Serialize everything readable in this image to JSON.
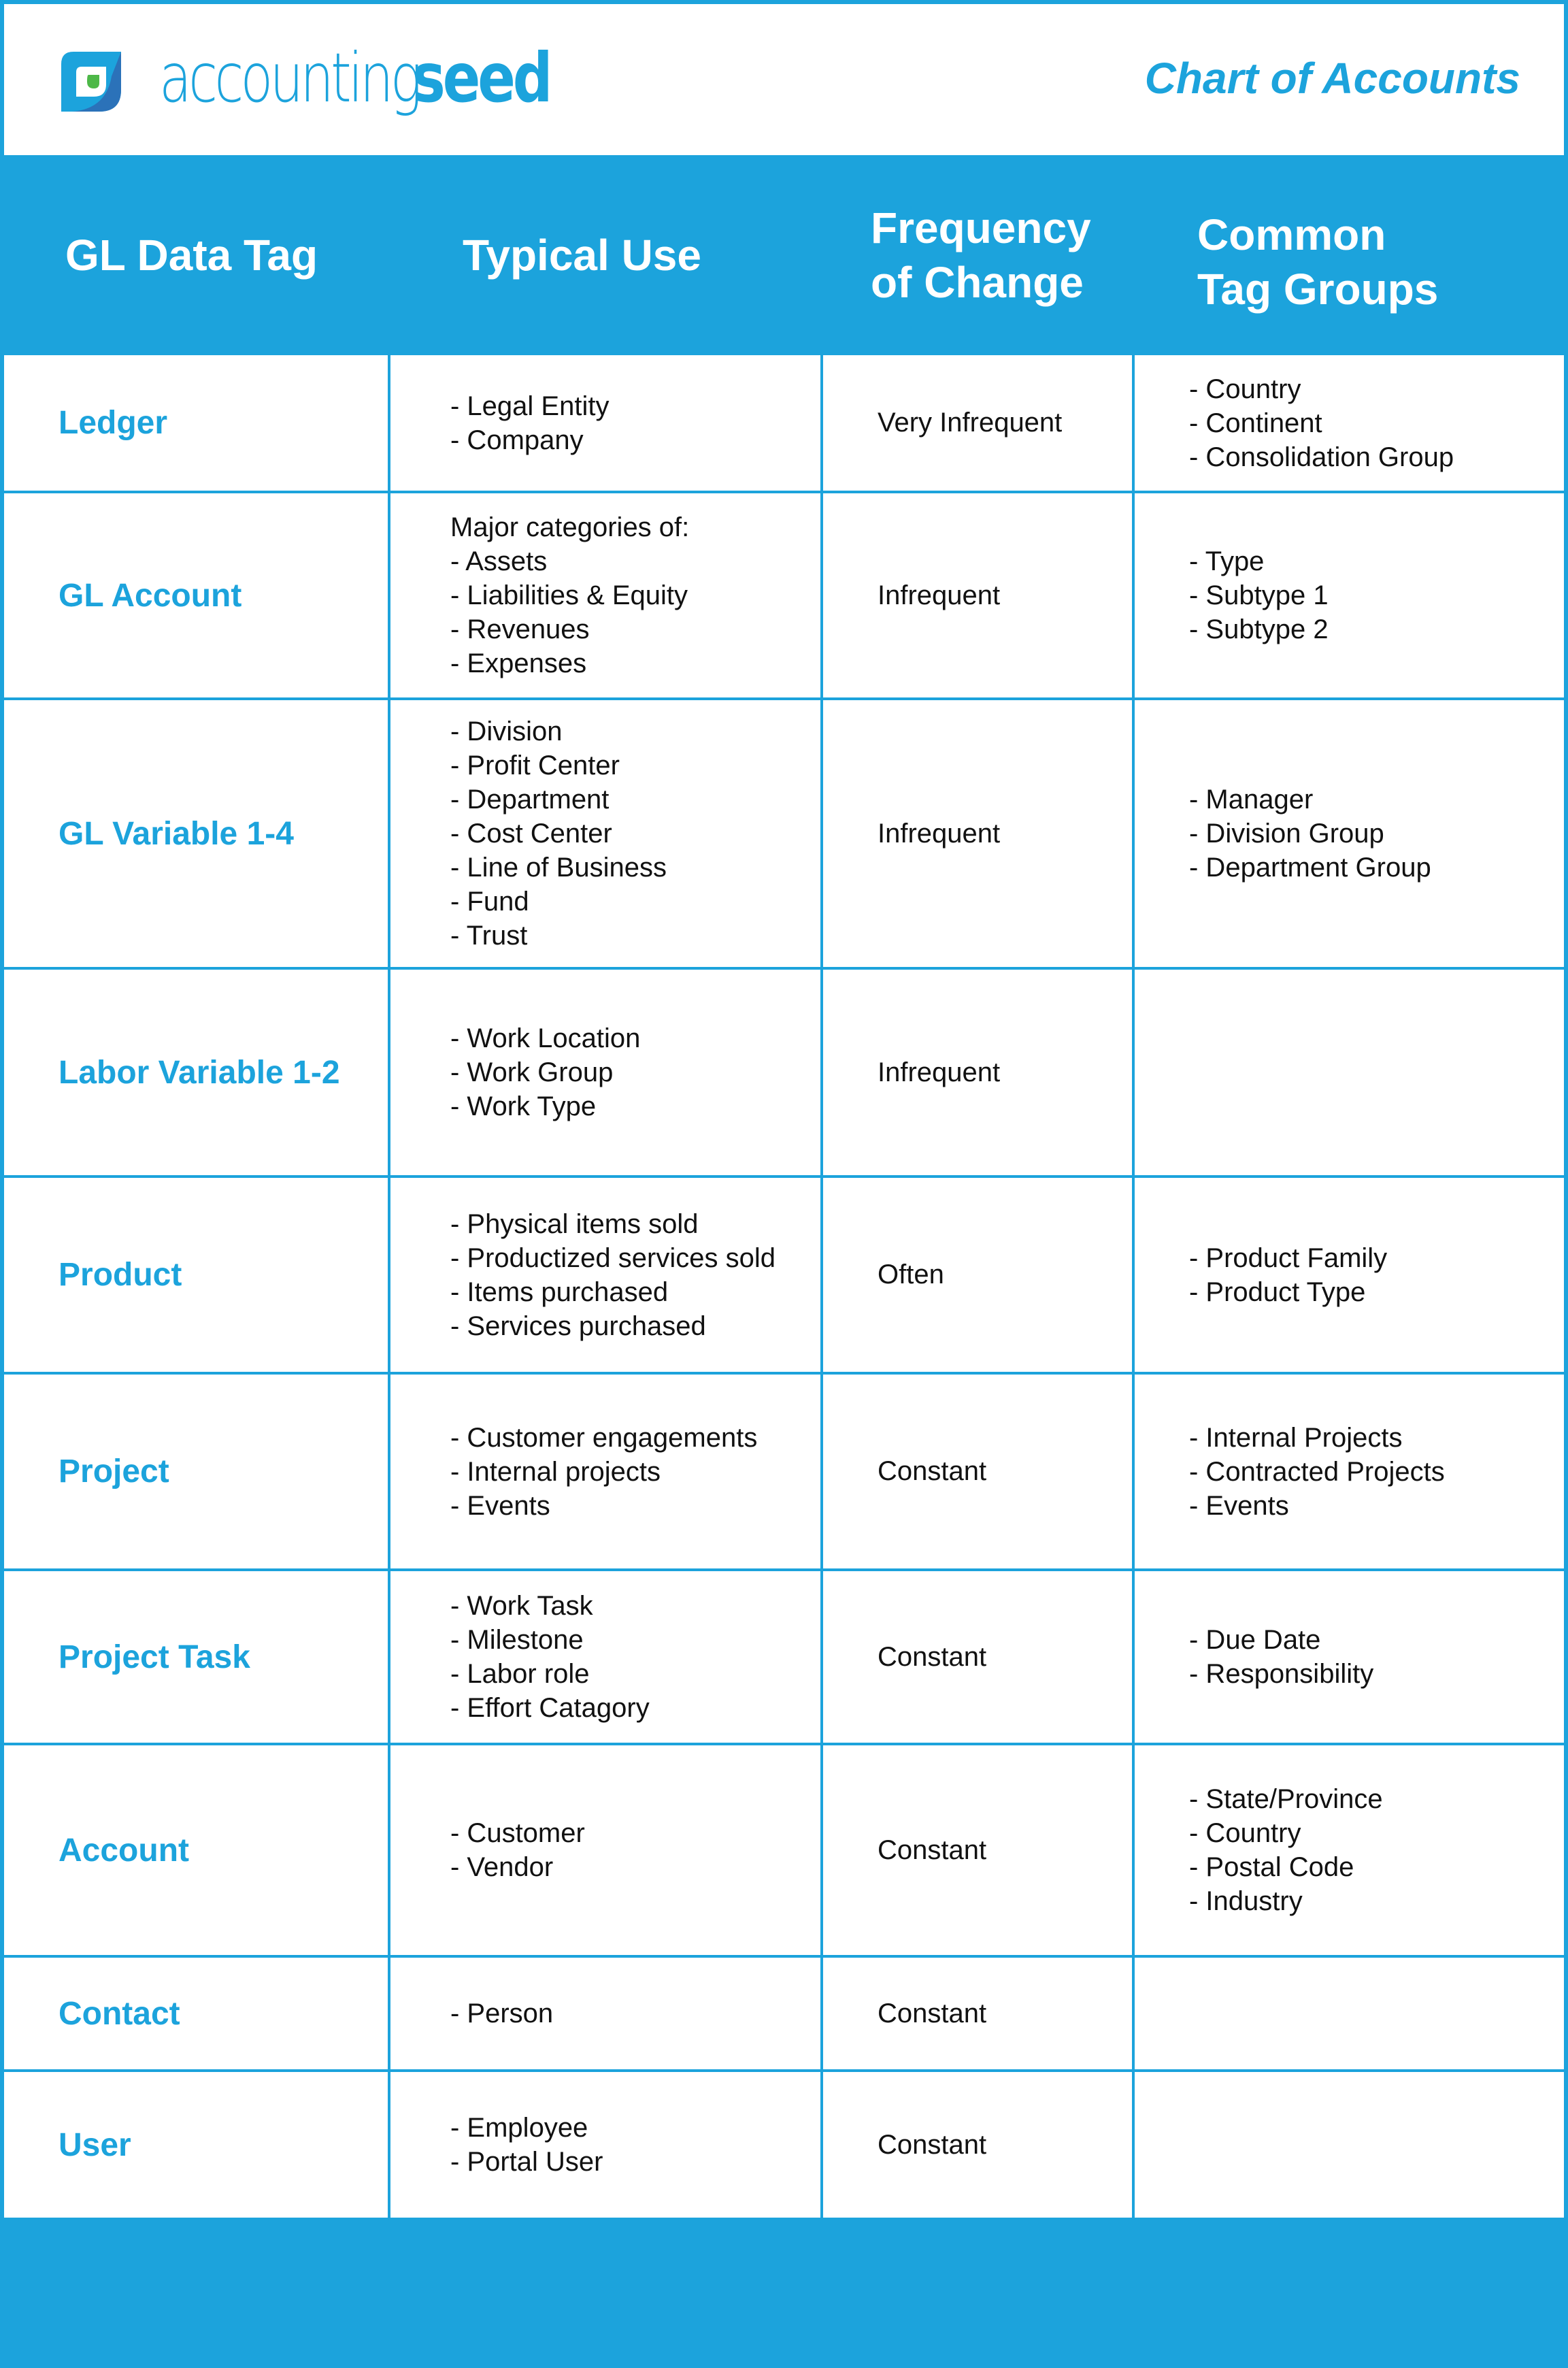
{
  "header": {
    "brand_light": "accounting",
    "brand_bold": "seed",
    "title": "Chart of Accounts",
    "logo_icon": "accounting-seed-leaf-logo"
  },
  "colors": {
    "accent": "#1ca3dc",
    "logo_dark": "#2b72b9",
    "logo_leaf": "#4db848",
    "text": "#111111",
    "background": "#ffffff"
  },
  "columns": {
    "tag": "GL Data Tag",
    "use": "Typical Use",
    "freq_line1": "Frequency",
    "freq_line2": "of Change",
    "groups_line1": "Common",
    "groups_line2": "Tag Groups"
  },
  "rows": [
    {
      "tag": "Ledger",
      "use": [
        "- Legal Entity",
        "- Company"
      ],
      "frequency": "Very Infrequent",
      "groups": [
        "- Country",
        "- Continent",
        "- Consolidation Group"
      ]
    },
    {
      "tag": "GL Account",
      "use": [
        "Major categories of:",
        "- Assets",
        "- Liabilities & Equity",
        "- Revenues",
        "- Expenses"
      ],
      "frequency": "Infrequent",
      "groups": [
        "- Type",
        "- Subtype 1",
        "- Subtype 2"
      ]
    },
    {
      "tag": "GL Variable 1-4",
      "use": [
        "- Division",
        "- Profit Center",
        "- Department",
        "- Cost Center",
        "- Line of Business",
        "- Fund",
        "- Trust"
      ],
      "frequency": "Infrequent",
      "groups": [
        "- Manager",
        "- Division Group",
        "- Department Group"
      ]
    },
    {
      "tag": "Labor Variable 1-2",
      "use": [
        "- Work Location",
        "- Work Group",
        "- Work Type"
      ],
      "frequency": "Infrequent",
      "groups": []
    },
    {
      "tag": "Product",
      "use": [
        "- Physical items sold",
        "- Productized services sold",
        "- Items purchased",
        "- Services purchased"
      ],
      "frequency": "Often",
      "groups": [
        "- Product Family",
        "- Product Type"
      ]
    },
    {
      "tag": "Project",
      "use": [
        "- Customer engagements",
        "- Internal projects",
        "- Events"
      ],
      "frequency": "Constant",
      "groups": [
        "- Internal Projects",
        "- Contracted Projects",
        "- Events"
      ]
    },
    {
      "tag": "Project Task",
      "use": [
        "- Work Task",
        "- Milestone",
        "- Labor role",
        "- Effort Catagory"
      ],
      "frequency": "Constant",
      "groups": [
        "- Due Date",
        "- Responsibility"
      ]
    },
    {
      "tag": "Account",
      "use": [
        "- Customer",
        "- Vendor"
      ],
      "frequency": "Constant",
      "groups": [
        "- State/Province",
        "- Country",
        "- Postal Code",
        "- Industry"
      ]
    },
    {
      "tag": "Contact",
      "use": [
        "- Person"
      ],
      "frequency": "Constant",
      "groups": []
    },
    {
      "tag": "User",
      "use": [
        "- Employee",
        "- Portal User"
      ],
      "frequency": "Constant",
      "groups": []
    }
  ]
}
